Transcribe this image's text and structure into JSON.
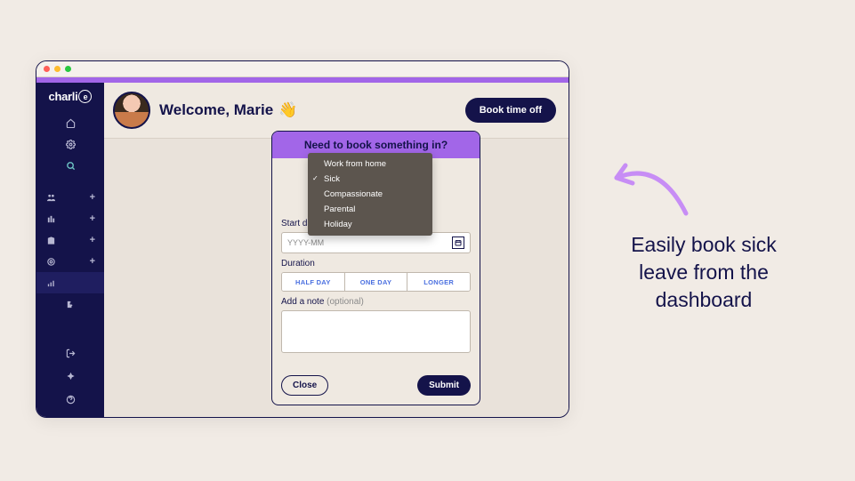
{
  "brand": {
    "name": "charli",
    "ring": "e"
  },
  "header": {
    "welcome": "Welcome, Marie",
    "wave": "👋",
    "book_btn": "Book time off"
  },
  "modal": {
    "title": "Need to book something in?",
    "start_label": "Start date",
    "date_placeholder": "YYYY-MM",
    "duration_label": "Duration",
    "seg": {
      "half": "HALF DAY",
      "one": "ONE DAY",
      "longer": "LONGER"
    },
    "note_label": "Add a note ",
    "note_optional": "(optional)",
    "close": "Close",
    "submit": "Submit"
  },
  "dropdown": {
    "items": [
      "Work from home",
      "Sick",
      "Compassionate",
      "Parental",
      "Holiday"
    ],
    "selected": "Sick"
  },
  "annotation": "Easily book sick leave from the dashboard",
  "colors": {
    "purple": "#a266e8",
    "navy": "#14134a",
    "cream": "#f1ebe5"
  }
}
